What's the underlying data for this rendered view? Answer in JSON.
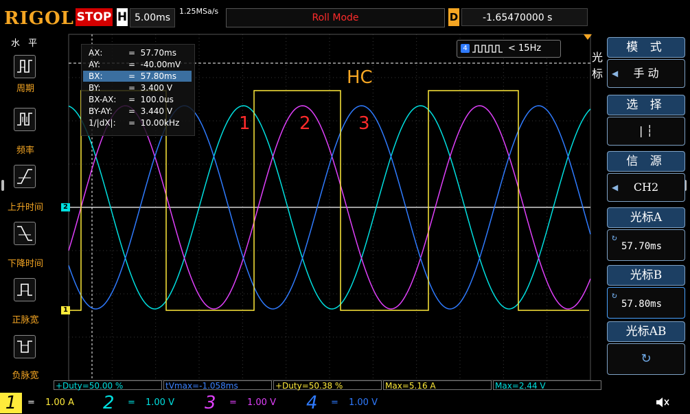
{
  "header": {
    "logo": "RIGOL",
    "run_state": "STOP",
    "timebase_label": "H",
    "timebase_value": "5.00ms",
    "sample_rate": "1.25MSa/s",
    "mode": "Roll Mode",
    "delay_label": "D",
    "delay_value": "-1.65470000 s"
  },
  "left_menu": {
    "title": "水 平",
    "items": [
      {
        "label": "周期",
        "icon": "period-icon"
      },
      {
        "label": "频率",
        "icon": "frequency-icon"
      },
      {
        "label": "上升时间",
        "icon": "rise-time-icon"
      },
      {
        "label": "下降时间",
        "icon": "fall-time-icon"
      },
      {
        "label": "正脉宽",
        "icon": "positive-width-icon"
      },
      {
        "label": "负脉宽",
        "icon": "negative-width-icon"
      }
    ]
  },
  "cursor_readout": {
    "rows": [
      {
        "key": "AX:",
        "value": "=  57.70ms"
      },
      {
        "key": "AY:",
        "value": "=  -40.00mV"
      },
      {
        "key": "BX:",
        "value": "=  57.80ms"
      },
      {
        "key": "BY:",
        "value": "=  3.400 V"
      },
      {
        "key": "BX-AX:",
        "value": "=  100.0us"
      },
      {
        "key": "BY-AY:",
        "value": "=  3.440 V"
      },
      {
        "key": "1/|dX|:",
        "value": "=  10.00kHz"
      }
    ]
  },
  "trigger_badge": {
    "channel": "4",
    "condition": "< 15Hz"
  },
  "annotations": {
    "hc": "HC",
    "n1": "1",
    "n2": "2",
    "n3": "3"
  },
  "markers": {
    "ch1": "1",
    "ch2": "2"
  },
  "right_menu": {
    "cursor_tab": "光\n标",
    "mode_title": "模 式",
    "mode_value": "手 动",
    "select_title": "选 择",
    "select_value": "|   ┆",
    "source_title": "信 源",
    "source_value": "CH2",
    "cursor_a_title": "光标A",
    "cursor_a_value": "57.70ms",
    "cursor_b_title": "光标B",
    "cursor_b_value": "57.80ms",
    "cursor_ab_title": "光标AB"
  },
  "measurements": [
    {
      "text": "+Duty=50.00 %",
      "color": "#00e0e0"
    },
    {
      "text": "tVmax=-1.058ms",
      "color": "#3b82ff"
    },
    {
      "text": "+Duty=50.38 %",
      "color": "#ffeb3b"
    },
    {
      "text": "Max=5.16 A",
      "color": "#ffeb3b"
    },
    {
      "text": "Max=2.44 V",
      "color": "#00e0e0"
    }
  ],
  "channels": [
    {
      "num": "1",
      "coupling": "=",
      "scale": "1.00 A",
      "color": "#ffeb3b"
    },
    {
      "num": "2",
      "coupling": "=",
      "scale": "1.00 V",
      "color": "#00e0e0"
    },
    {
      "num": "3",
      "coupling": "=",
      "scale": "1.00 V",
      "color": "#e040fb"
    },
    {
      "num": "4",
      "coupling": "=",
      "scale": "1.00 V",
      "color": "#2f7bff"
    }
  ],
  "colors": {
    "ch1": "#ffeb3b",
    "ch2": "#00e0e0",
    "ch3": "#e040fb",
    "ch4": "#2f7bff",
    "accent": "#f5a623"
  }
}
